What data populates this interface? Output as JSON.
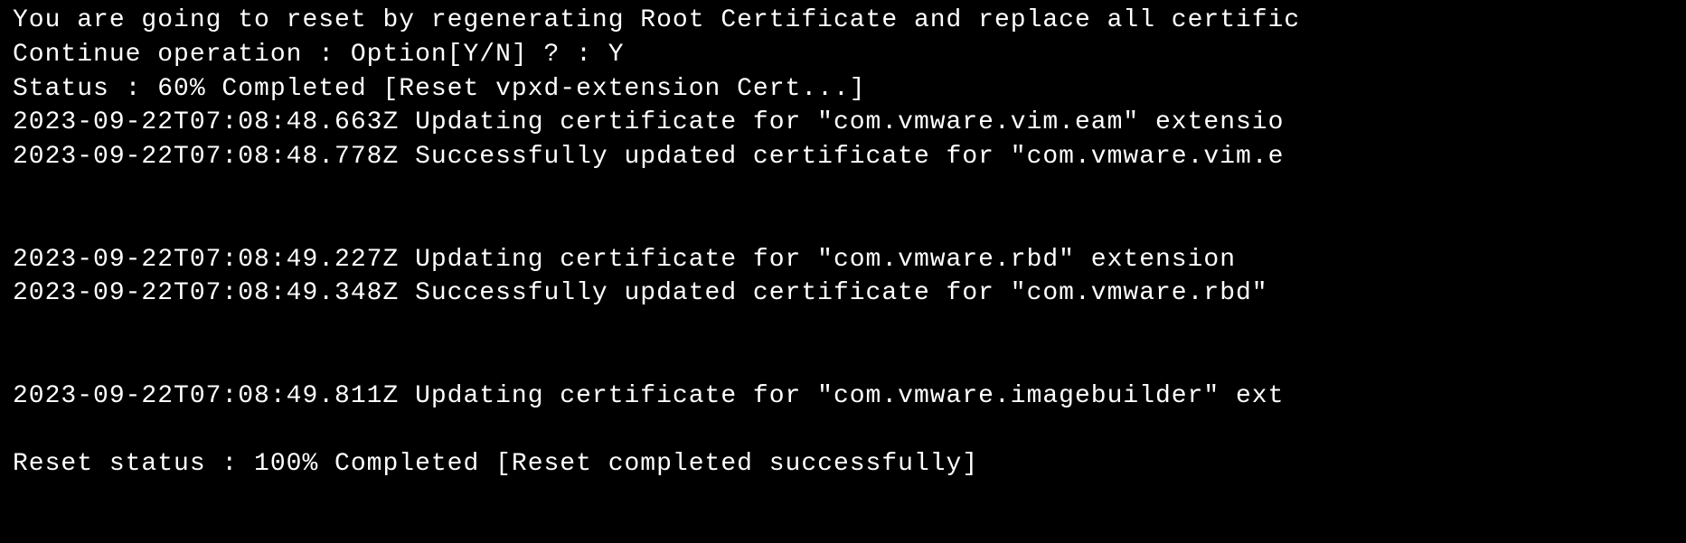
{
  "terminal": {
    "lines": [
      "You are going to reset by regenerating Root Certificate and replace all certific",
      "Continue operation : Option[Y/N] ? : Y",
      "Status : 60% Completed [Reset vpxd-extension Cert...]",
      "2023-09-22T07:08:48.663Z  Updating certificate for \"com.vmware.vim.eam\" extensio",
      "2023-09-22T07:08:48.778Z  Successfully updated certificate for \"com.vmware.vim.e",
      "",
      "",
      "2023-09-22T07:08:49.227Z  Updating certificate for \"com.vmware.rbd\" extension",
      "2023-09-22T07:08:49.348Z  Successfully updated certificate for \"com.vmware.rbd\"",
      "",
      "",
      "2023-09-22T07:08:49.811Z  Updating certificate for \"com.vmware.imagebuilder\" ext",
      "",
      "Reset status : 100% Completed [Reset completed successfully]"
    ]
  }
}
